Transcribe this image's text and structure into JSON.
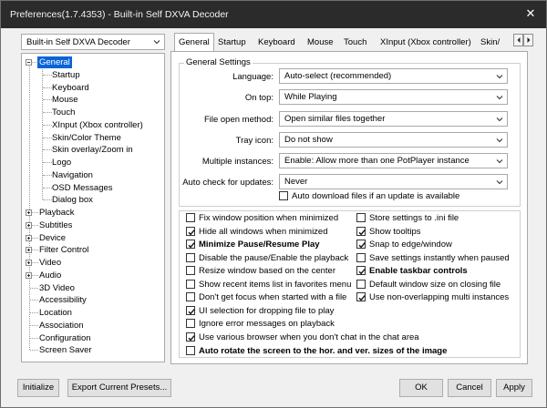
{
  "window": {
    "title": "Preferences(1.7.4353) - Built-in Self DXVA Decoder"
  },
  "sidebar": {
    "profile_combo": "Built-in Self DXVA Decoder",
    "tree": [
      {
        "label": "General",
        "level": 0,
        "expander": "minus",
        "selected": true
      },
      {
        "label": "Startup",
        "level": 1
      },
      {
        "label": "Keyboard",
        "level": 1
      },
      {
        "label": "Mouse",
        "level": 1
      },
      {
        "label": "Touch",
        "level": 1
      },
      {
        "label": "XInput (Xbox controller)",
        "level": 1
      },
      {
        "label": "Skin/Color Theme",
        "level": 1
      },
      {
        "label": "Skin overlay/Zoom in",
        "level": 1
      },
      {
        "label": "Logo",
        "level": 1
      },
      {
        "label": "Navigation",
        "level": 1
      },
      {
        "label": "OSD Messages",
        "level": 1
      },
      {
        "label": "Dialog box",
        "level": 1
      },
      {
        "label": "Playback",
        "level": 0,
        "expander": "plus"
      },
      {
        "label": "Subtitles",
        "level": 0,
        "expander": "plus"
      },
      {
        "label": "Device",
        "level": 0,
        "expander": "plus"
      },
      {
        "label": "Filter Control",
        "level": 0,
        "expander": "plus"
      },
      {
        "label": "Video",
        "level": 0,
        "expander": "plus"
      },
      {
        "label": "Audio",
        "level": 0,
        "expander": "plus"
      },
      {
        "label": "3D Video",
        "level": 0
      },
      {
        "label": "Accessibility",
        "level": 0
      },
      {
        "label": "Location",
        "level": 0
      },
      {
        "label": "Association",
        "level": 0
      },
      {
        "label": "Configuration",
        "level": 0
      },
      {
        "label": "Screen Saver",
        "level": 0
      }
    ]
  },
  "tabs": [
    {
      "label": "General",
      "active": true
    },
    {
      "label": "Startup"
    },
    {
      "label": "Keyboard"
    },
    {
      "label": "Mouse"
    },
    {
      "label": "Touch"
    },
    {
      "label": "XInput (Xbox controller)"
    },
    {
      "label": "Skin/"
    }
  ],
  "general_settings": {
    "title": "General Settings",
    "fields": [
      {
        "label": "Language:",
        "value": "Auto-select (recommended)"
      },
      {
        "label": "On top:",
        "value": "While Playing"
      },
      {
        "label": "File open method:",
        "value": "Open similar files together"
      },
      {
        "label": "Tray icon:",
        "value": "Do not show"
      },
      {
        "label": "Multiple instances:",
        "value": "Enable: Allow more than one PotPlayer instance"
      },
      {
        "label": "Auto check for updates:",
        "value": "Never"
      }
    ],
    "auto_download": {
      "label": "Auto download files if an update is available",
      "checked": false
    }
  },
  "options_left": [
    {
      "label": "Fix window position when minimized",
      "checked": false
    },
    {
      "label": "Hide all windows when minimized",
      "checked": true
    },
    {
      "label": "Minimize Pause/Resume Play",
      "checked": true,
      "bold": true
    },
    {
      "label": "Disable the pause/Enable the playback",
      "checked": false
    },
    {
      "label": "Resize window based on the center",
      "checked": false
    },
    {
      "label": "Show recent items list in favorites menu",
      "checked": false
    },
    {
      "label": "Don't get focus when started with a file",
      "checked": false
    },
    {
      "label": "UI selection for dropping file to play",
      "checked": true
    },
    {
      "label": "Ignore error messages on playback",
      "checked": false
    },
    {
      "label": "Use various browser when you don't chat in the chat area",
      "checked": true
    },
    {
      "label": "Auto rotate the screen to the hor. and ver. sizes of the image",
      "checked": false,
      "bold": true
    }
  ],
  "options_right": [
    {
      "label": "Store settings to .ini file",
      "checked": false
    },
    {
      "label": "Show tooltips",
      "checked": true
    },
    {
      "label": "Snap to edge/window",
      "checked": true
    },
    {
      "label": "Save settings instantly when paused",
      "checked": false
    },
    {
      "label": "Enable taskbar controls",
      "checked": true,
      "bold": true
    },
    {
      "label": "Default window size on closing file",
      "checked": false
    },
    {
      "label": "Use non-overlapping multi instances",
      "checked": true
    }
  ],
  "buttons": {
    "initialize": "Initialize",
    "export": "Export Current Presets...",
    "ok": "OK",
    "cancel": "Cancel",
    "apply": "Apply"
  },
  "colors": {
    "titlebar": "#2b2b2b",
    "selection": "#0a64d6"
  }
}
